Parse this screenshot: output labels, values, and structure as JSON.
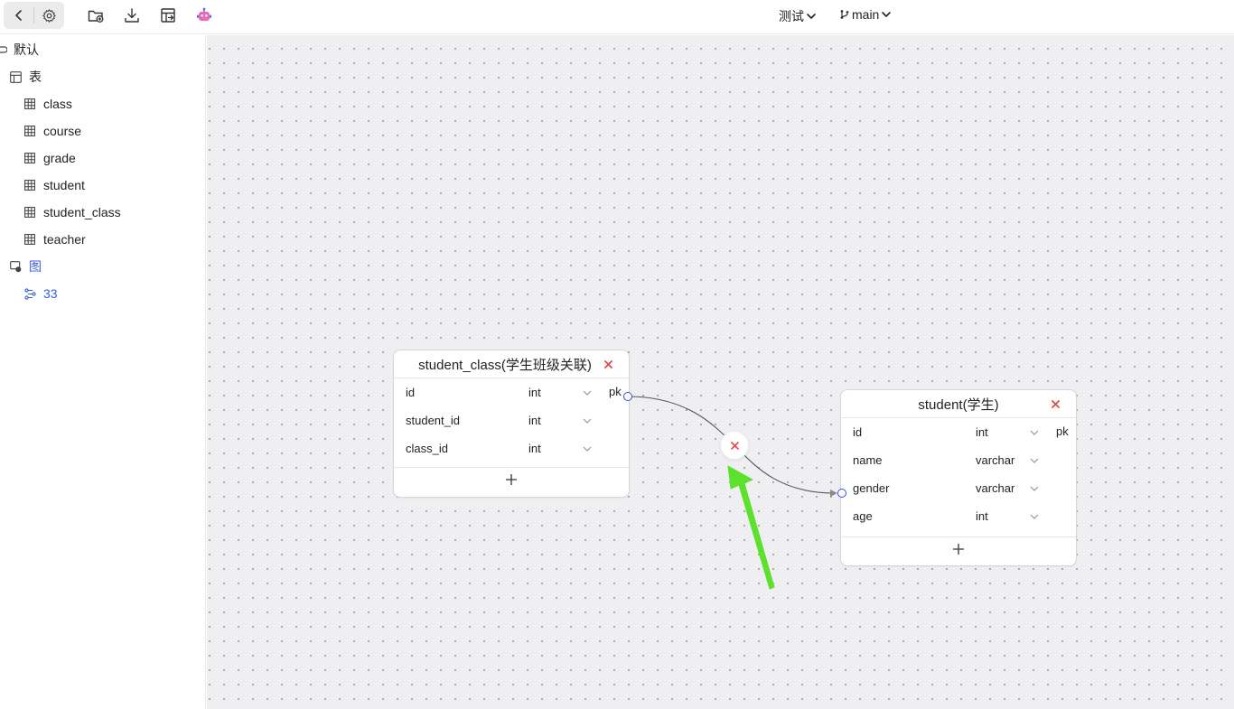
{
  "toolbar": {
    "back_icon": "chevron-left-icon",
    "settings_icon": "gear-icon",
    "tools": [
      "folder-add-icon",
      "download-icon",
      "table-export-icon",
      "robot-icon"
    ],
    "project": "测试",
    "branch": "main"
  },
  "sidebar": {
    "root": "默认",
    "tables_group": "表",
    "tables": [
      "class",
      "course",
      "grade",
      "student",
      "student_class",
      "teacher"
    ],
    "diagrams_group": "图",
    "diagrams": [
      "33"
    ]
  },
  "canvas": {
    "tables": [
      {
        "title": "student_class(学生班级关联)",
        "fields": [
          {
            "name": "id",
            "type": "int",
            "key": "pk"
          },
          {
            "name": "student_id",
            "type": "int",
            "key": ""
          },
          {
            "name": "class_id",
            "type": "int",
            "key": ""
          }
        ],
        "add_label": "+"
      },
      {
        "title": "student(学生)",
        "fields": [
          {
            "name": "id",
            "type": "int",
            "key": "pk"
          },
          {
            "name": "name",
            "type": "varchar",
            "key": ""
          },
          {
            "name": "gender",
            "type": "varchar",
            "key": ""
          },
          {
            "name": "age",
            "type": "int",
            "key": ""
          }
        ],
        "add_label": "+"
      }
    ],
    "relation": {
      "from_table": "student_class",
      "from_field": "id",
      "to_table": "student",
      "to_field": "gender"
    }
  },
  "colors": {
    "accent": "#3b5bdb",
    "port": "#3b4bd8",
    "delete": "#e5484d",
    "arrow": "#5ce22e",
    "canvas_bg": "#efeff1"
  }
}
